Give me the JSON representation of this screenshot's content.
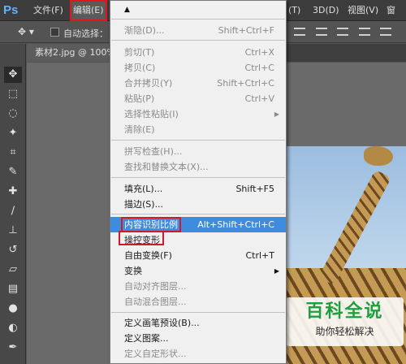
{
  "app": {
    "logo": "Ps"
  },
  "menubar": {
    "items": [
      {
        "label": "文件(F)"
      },
      {
        "label": "编辑(E)"
      },
      {
        "label": "(T)"
      },
      {
        "label": "3D(D)"
      },
      {
        "label": "视图(V)"
      },
      {
        "label": "窗"
      }
    ]
  },
  "options": {
    "auto_select_label": "自动选择："
  },
  "document": {
    "tab_title": "素材2.jpg @ 100%"
  },
  "edit_menu": {
    "items": [
      {
        "label": "渐隐(D)...",
        "shortcut": "Shift+Ctrl+F",
        "disabled": true
      },
      {
        "label": "剪切(T)",
        "shortcut": "Ctrl+X",
        "disabled": true
      },
      {
        "label": "拷贝(C)",
        "shortcut": "Ctrl+C",
        "disabled": true
      },
      {
        "label": "合并拷贝(Y)",
        "shortcut": "Shift+Ctrl+C",
        "disabled": true
      },
      {
        "label": "粘贴(P)",
        "shortcut": "Ctrl+V",
        "disabled": true
      },
      {
        "label": "选择性粘贴(I)",
        "shortcut": "",
        "disabled": true,
        "submenu": true
      },
      {
        "label": "清除(E)",
        "shortcut": "",
        "disabled": true
      },
      {
        "label": "拼写检查(H)...",
        "shortcut": "",
        "disabled": true
      },
      {
        "label": "查找和替换文本(X)...",
        "shortcut": "",
        "disabled": true
      },
      {
        "label": "填充(L)...",
        "shortcut": "Shift+F5",
        "disabled": false
      },
      {
        "label": "描边(S)...",
        "shortcut": "",
        "disabled": false
      },
      {
        "label": "内容识别比例",
        "shortcut": "Alt+Shift+Ctrl+C",
        "disabled": false,
        "highlighted": true
      },
      {
        "label": "操控变形",
        "shortcut": "",
        "disabled": false
      },
      {
        "label": "自由变换(F)",
        "shortcut": "Ctrl+T",
        "disabled": false
      },
      {
        "label": "变换",
        "shortcut": "",
        "disabled": false,
        "submenu": true
      },
      {
        "label": "自动对齐图层...",
        "shortcut": "",
        "disabled": true
      },
      {
        "label": "自动混合图层...",
        "shortcut": "",
        "disabled": true
      },
      {
        "label": "定义画笔预设(B)...",
        "shortcut": "",
        "disabled": false
      },
      {
        "label": "定义图案...",
        "shortcut": "",
        "disabled": false
      },
      {
        "label": "定义自定形状...",
        "shortcut": "",
        "disabled": true
      }
    ]
  },
  "watermark": {
    "title": "百科全说",
    "subtitle": "助你轻松解决"
  },
  "colors": {
    "highlight": "#3e8ce0",
    "annotation_red": "#d51826",
    "logo_blue": "#5fb4ff"
  },
  "tools": [
    {
      "icon": "move-icon"
    },
    {
      "icon": "marquee-icon"
    },
    {
      "icon": "lasso-icon"
    },
    {
      "icon": "magic-wand-icon"
    },
    {
      "icon": "crop-icon"
    },
    {
      "icon": "eyedropper-icon"
    },
    {
      "icon": "healing-brush-icon"
    },
    {
      "icon": "brush-icon"
    },
    {
      "icon": "clone-stamp-icon"
    },
    {
      "icon": "history-brush-icon"
    },
    {
      "icon": "eraser-icon"
    },
    {
      "icon": "gradient-icon"
    },
    {
      "icon": "blur-icon"
    },
    {
      "icon": "dodge-icon"
    },
    {
      "icon": "pen-icon"
    }
  ]
}
